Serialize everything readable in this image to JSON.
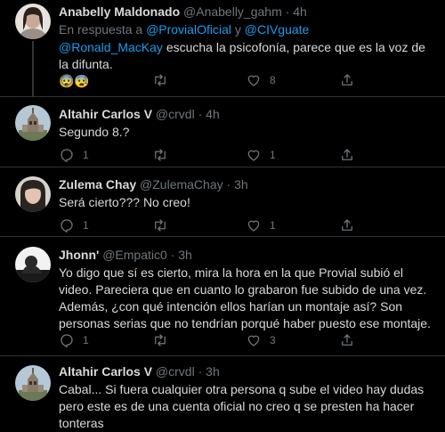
{
  "tweets": [
    {
      "name": "Anabelly Maldonado",
      "handle": "@Anabelly_gahm",
      "dot": "·",
      "time": "4h",
      "reply_prefix": "En respuesta a ",
      "reply_user1": "@ProvialOficial",
      "reply_and": " y ",
      "reply_user2": "@CIVguate",
      "mention": "@Ronald_MacKay",
      "body": " escucha la psicofonía, parece que es la voz de la difunta.",
      "emoji": "😨😨",
      "replies": "1",
      "retweets": "",
      "likes": "8"
    },
    {
      "name": "Altahir Carlos V",
      "handle": "@crvdl",
      "dot": "·",
      "time": "4h",
      "body": "Segundo 8.?",
      "replies": "1",
      "retweets": "",
      "likes": "1"
    },
    {
      "name": "Zulema Chay",
      "handle": "@ZulemaChay",
      "dot": "·",
      "time": "3h",
      "body": "Será cierto??? No creo!",
      "replies": "1",
      "retweets": "",
      "likes": "1"
    },
    {
      "name": "Jhonn'",
      "handle": "@Empatic0",
      "dot": "·",
      "time": "3h",
      "body": "Yo digo que sí es cierto, mira la hora en la que Provial subió el video. Pareciera que en cuanto lo grabaron fue subido de una vez. Además, ¿con qué intención ellos harían un montaje así? Son personas serias que no tendrían porqué haber puesto ese montaje.",
      "replies": "1",
      "retweets": "",
      "likes": "3"
    },
    {
      "name": "Altahir Carlos V",
      "handle": "@crvdl",
      "dot": "·",
      "time": "3h",
      "body": "Cabal... Si fuera cualquier otra persona q sube el video hay dudas pero este es de una cuenta oficial no creo q se presten ha hacer tonteras"
    }
  ],
  "more_label": "···",
  "colors": {
    "background": "#000000",
    "text": "#d9d9d9",
    "muted": "#6e767d",
    "link": "#1d9bf0",
    "divider": "#2f3336"
  },
  "icons": [
    "reply-icon",
    "retweet-icon",
    "like-icon",
    "share-icon",
    "more-icon"
  ]
}
